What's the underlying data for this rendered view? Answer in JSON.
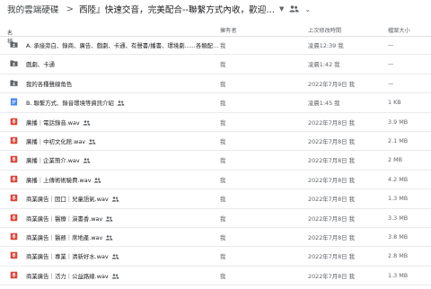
{
  "breadcrumb": {
    "root": "我的雲端硬碟",
    "separator": ">",
    "current": "西陸』快速交音，完美配合--聯繫方式內收，歡迎詳洽--"
  },
  "columns": {
    "name": "名稱",
    "sort_arrow": "↓",
    "owner": "擁有者",
    "modified": "上次修改時間",
    "size": "檔案大小"
  },
  "colors": {
    "folder": "#5f6368",
    "doc": "#4285f4",
    "audio": "#db4437"
  },
  "rows": [
    {
      "icon": "folder-shared",
      "name": "A. 承接旁白、錄商、廣告、戲劇、卡通、有聲書/播書、環境劇......各類配音業務",
      "shared": false,
      "owner": "我",
      "modified": "凌晨12:39 我",
      "size": "—"
    },
    {
      "icon": "folder-shared",
      "name": "戲劇、卡通",
      "shared": false,
      "owner": "我",
      "modified": "凌晨1:42 我",
      "size": "—"
    },
    {
      "icon": "folder-shared",
      "name": "我的各種聲線角色",
      "shared": false,
      "owner": "我",
      "modified": "2022年7月9日 我",
      "size": "—"
    },
    {
      "icon": "doc",
      "name": "B. 聯繫方式、錄音環境等資訊介紹",
      "shared": true,
      "owner": "我",
      "modified": "凌晨1:45 我",
      "size": "1 KB"
    },
    {
      "icon": "audio",
      "name": "廣播｜電話錄音.wav",
      "shared": true,
      "owner": "我",
      "modified": "2022年7月8日 我",
      "size": "3.9 MB"
    },
    {
      "icon": "audio",
      "name": "廣播｜中初文化館.wav",
      "shared": true,
      "owner": "我",
      "modified": "2022年7月8日 我",
      "size": "2.1 MB"
    },
    {
      "icon": "audio",
      "name": "廣播｜企業簡介.wav",
      "shared": true,
      "owner": "我",
      "modified": "2022年7月8日 我",
      "size": "2 MB"
    },
    {
      "icon": "audio",
      "name": "廣播｜上傳術術驗費.wav",
      "shared": true,
      "owner": "我",
      "modified": "2022年7月8日 我",
      "size": "4.2 MB"
    },
    {
      "icon": "audio",
      "name": "商業廣告｜囡囗｜兒童語氣.wav",
      "shared": true,
      "owner": "我",
      "modified": "2022年7月8日 我",
      "size": "1.3 MB"
    },
    {
      "icon": "audio",
      "name": "商業廣告｜醫療｜演書香.wav",
      "shared": true,
      "owner": "我",
      "modified": "2022年7月8日 我",
      "size": "3.3 MB"
    },
    {
      "icon": "audio",
      "name": "商業廣告｜醫務｜席地產.wav",
      "shared": true,
      "owner": "我",
      "modified": "2022年7月8日 我",
      "size": "3.8 MB"
    },
    {
      "icon": "audio",
      "name": "商業廣告｜專業｜清新好水.wav",
      "shared": true,
      "owner": "我",
      "modified": "2022年7月8日 我",
      "size": "2.8 MB"
    },
    {
      "icon": "audio",
      "name": "商業廣告｜活力｜公益路線.wav",
      "shared": true,
      "owner": "我",
      "modified": "2022年7月8日 我",
      "size": "1.3 MB"
    }
  ]
}
